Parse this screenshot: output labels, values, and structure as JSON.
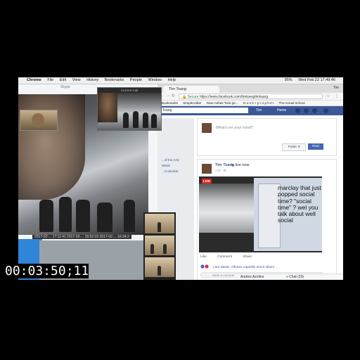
{
  "menubar": {
    "app": "Chrome",
    "items": [
      "File",
      "Edit",
      "View",
      "History",
      "Bookmarks",
      "People",
      "Window",
      "Help"
    ],
    "clock": "Wed Feb 22  17:49:46",
    "battery": "95%"
  },
  "skype": {
    "window_title": "Skype",
    "call_title": "Current Call",
    "timestamps": "2017-02-... 17:11:41   2017-02-... 16:52:19   2017-02-... 16:34:2"
  },
  "chrome": {
    "tab_title": "Tim Tsang",
    "profile": "Tim",
    "url_secure": "Secure",
    "url": "https://www.facebook.com/timtsangtimtsang",
    "bookmarks": [
      "Bookmarks",
      "SimpleAdder",
      "Rare Ashes Twin ge...",
      "m o n k + p r o p h e t",
      "The Actual School"
    ]
  },
  "facebook": {
    "search_value": "Tsang",
    "user": "Tim",
    "home": "Home",
    "composer_placeholder": "What's on your mind?",
    "public_label": "Public ▾",
    "post_label": "Post",
    "post": {
      "author": "Tim Tsang",
      "status": "is live now.",
      "time": "1 hr · ⚙",
      "live_badge": "LIVE",
      "caption": "marclay that just popped social time? \"social time\" ? wel you talk about well social",
      "actions": [
        "Like",
        "Comment",
        "Share"
      ],
      "likers": "Lara Nasim, Alfonso Capetillo and 6 others",
      "comment_placeholder": "Write a comment..."
    },
    "sidebar_links": [
      "...of the Arts",
      "Music",
      "...Columbia"
    ],
    "chat_user": "Andres Azoline",
    "chat_label": "Chat (33)"
  },
  "timecode": "00:03:50;11"
}
